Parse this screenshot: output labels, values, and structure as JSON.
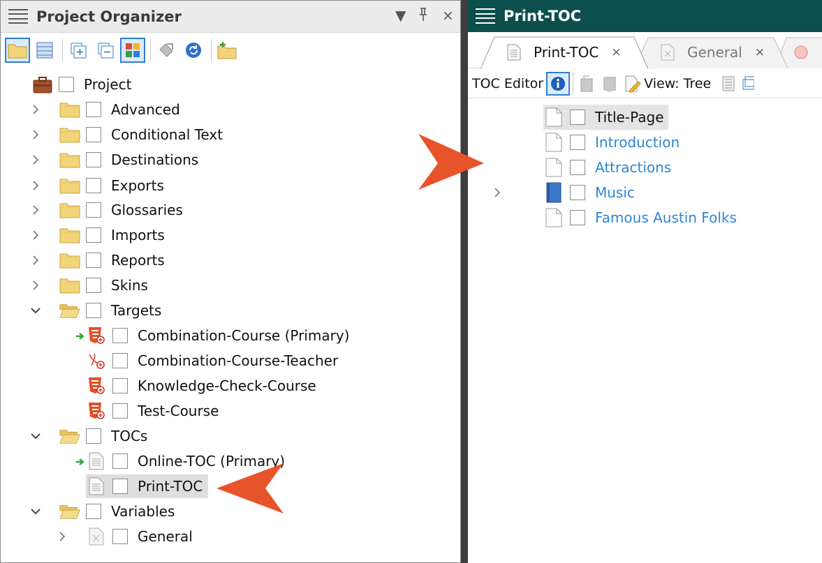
{
  "left_pane": {
    "title": "Project Organizer",
    "controls": {
      "dropdown": "▼",
      "pin": "Ꮘ",
      "close": "×"
    }
  },
  "tree": {
    "root": {
      "label": "Project"
    },
    "items": [
      {
        "label": "Advanced"
      },
      {
        "label": "Conditional Text"
      },
      {
        "label": "Destinations"
      },
      {
        "label": "Exports"
      },
      {
        "label": "Glossaries"
      },
      {
        "label": "Imports"
      },
      {
        "label": "Reports"
      },
      {
        "label": "Skins"
      },
      {
        "label": "Targets"
      },
      {
        "label": "Combination-Course (Primary)"
      },
      {
        "label": "Combination-Course-Teacher"
      },
      {
        "label": "Knowledge-Check-Course"
      },
      {
        "label": "Test-Course"
      },
      {
        "label": "TOCs"
      },
      {
        "label": "Online-TOC (Primary)"
      },
      {
        "label": "Print-TOC"
      },
      {
        "label": "Variables"
      },
      {
        "label": "General"
      }
    ]
  },
  "right_pane": {
    "title": "Print-TOC",
    "tabs": [
      {
        "label": "Print-TOC",
        "close": "×"
      },
      {
        "label": "General",
        "close": "×"
      }
    ],
    "toolbar": {
      "editor_label": "TOC Editor",
      "view_label": "View: Tree"
    }
  },
  "toc": {
    "items": [
      {
        "label": "Title-Page"
      },
      {
        "label": "Introduction"
      },
      {
        "label": "Attractions"
      },
      {
        "label": "Music"
      },
      {
        "label": "Famous Austin Folks"
      }
    ]
  },
  "colors": {
    "accent": "#2f7fd0",
    "link": "#2f86d6",
    "title_bar_right": "#0d4f4d",
    "pointer": "#e8542a",
    "folder": "#f2d479"
  }
}
